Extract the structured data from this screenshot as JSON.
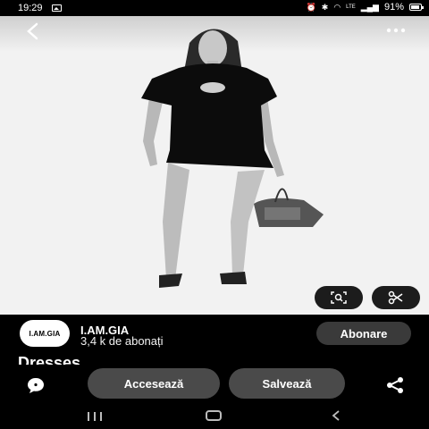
{
  "status_bar": {
    "time": "19:29",
    "network_label": "LTE",
    "battery": "91%"
  },
  "photo": {
    "description_icon": "photo-of-person-in-black-dress"
  },
  "creator": {
    "avatar_text": "I.AM.GIA",
    "name": "I.AM.GIA",
    "followers": "3,4 k de abonați",
    "subscribe_label": "Abonare"
  },
  "pin": {
    "title": "Dresses"
  },
  "actions": {
    "visit_label": "Accesează",
    "save_label": "Salvează"
  },
  "colors": {
    "background": "#000000",
    "photo_bg": "#f2f2f2",
    "button_bg": "#4a4a4a",
    "subscribe_bg": "#3a3a3a"
  }
}
